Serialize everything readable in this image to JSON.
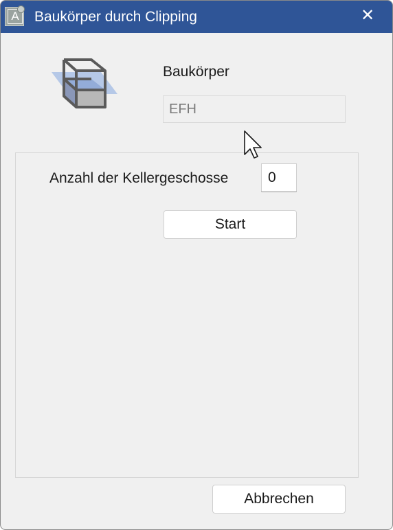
{
  "window": {
    "title": "Baukörper durch Clipping",
    "app_icon_letter": "A",
    "close_symbol": "✕",
    "titlebar_color": "#2f5597",
    "background_color": "#f0f0f0"
  },
  "header": {
    "icon": "building-body-clipping-icon",
    "body_label": "Baukörper",
    "body_field_value": "EFH"
  },
  "group": {
    "basement_label": "Anzahl der Kellergeschosse",
    "basement_value": "0",
    "start_label": "Start"
  },
  "footer": {
    "cancel_label": "Abbrechen"
  }
}
